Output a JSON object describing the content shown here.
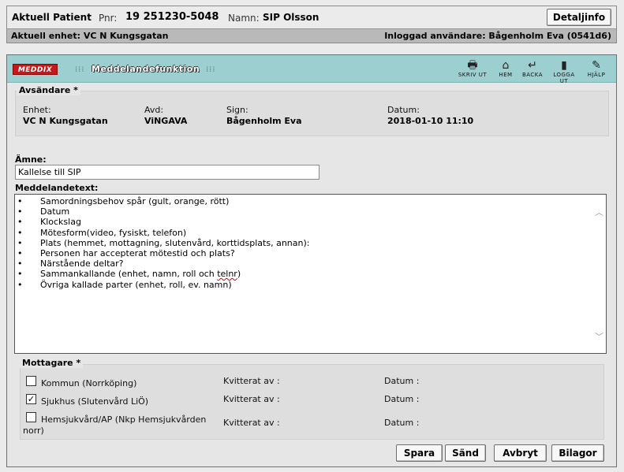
{
  "patient": {
    "title": "Aktuell Patient",
    "pnr_label": "Pnr:",
    "pnr_value": "19 251230-5048",
    "name_label": "Namn:",
    "name_value": "SIP Olsson",
    "detail_button": "Detaljinfo",
    "unit_text": "Aktuell enhet: VC N Kungsgatan",
    "user_text": "Inloggad användare: Bågenholm Eva (0541d6)"
  },
  "titlebar": {
    "logo": "MEDDIX",
    "module": "Meddelandefunktion",
    "tools": [
      {
        "icon": "printer-icon",
        "glyph": "🖶",
        "label": "SKRIV UT"
      },
      {
        "icon": "home-icon",
        "glyph": "⌂",
        "label": "HEM"
      },
      {
        "icon": "back-arrow-icon",
        "glyph": "↵",
        "label": "BACKA"
      },
      {
        "icon": "logout-door-icon",
        "glyph": "▮",
        "label": "LOGGA UT"
      },
      {
        "icon": "help-book-icon",
        "glyph": "✎",
        "label": "HJÄLP"
      }
    ]
  },
  "sender": {
    "legend": "Avsändare *",
    "unit_label": "Enhet:",
    "unit_value": "VC N Kungsgatan",
    "dept_label": "Avd:",
    "dept_value": "ViNGAVA",
    "sign_label": "Sign:",
    "sign_value": "Bågenholm Eva",
    "date_label": "Datum:",
    "date_value": "2018-01-10 11:10"
  },
  "subject": {
    "label": "Ämne:",
    "value": "Kallelse till SIP"
  },
  "message": {
    "label": "Meddelandetext:",
    "bullet": "•",
    "lines": [
      "Samordningsbehov spår (gult, orange, rött)",
      "Datum",
      "Klockslag",
      "Mötesform(video, fysiskt, telefon)",
      "Plats (hemmet, mottagning, slutenvård, korttidsplats, annan):",
      "Personen har accepterat mötestid och plats?",
      "Närstående deltar?"
    ],
    "line8_before": "Sammankallande (enhet, namn, roll och ",
    "line8_misspelled": "telnr",
    "line8_after": ")",
    "line9": "Övriga kallade parter (enhet, roll, ev. namn)"
  },
  "recipients": {
    "legend": "Mottagare *",
    "ack_label": "Kvitterat av :",
    "date_label": "Datum :",
    "items": [
      {
        "label": "Kommun (Norrköping)",
        "checked": false
      },
      {
        "label": "Sjukhus (Slutenvård LiÖ)",
        "checked": true
      },
      {
        "label_line1": "Hemsjukvård/AP (Nkp Hemsjukvården",
        "label_line2": "norr)",
        "checked": false
      }
    ],
    "check_mark": "✓"
  },
  "actions": {
    "save": "Spara",
    "send": "Sänd",
    "cancel": "Avbryt",
    "attachments": "Bilagor"
  }
}
